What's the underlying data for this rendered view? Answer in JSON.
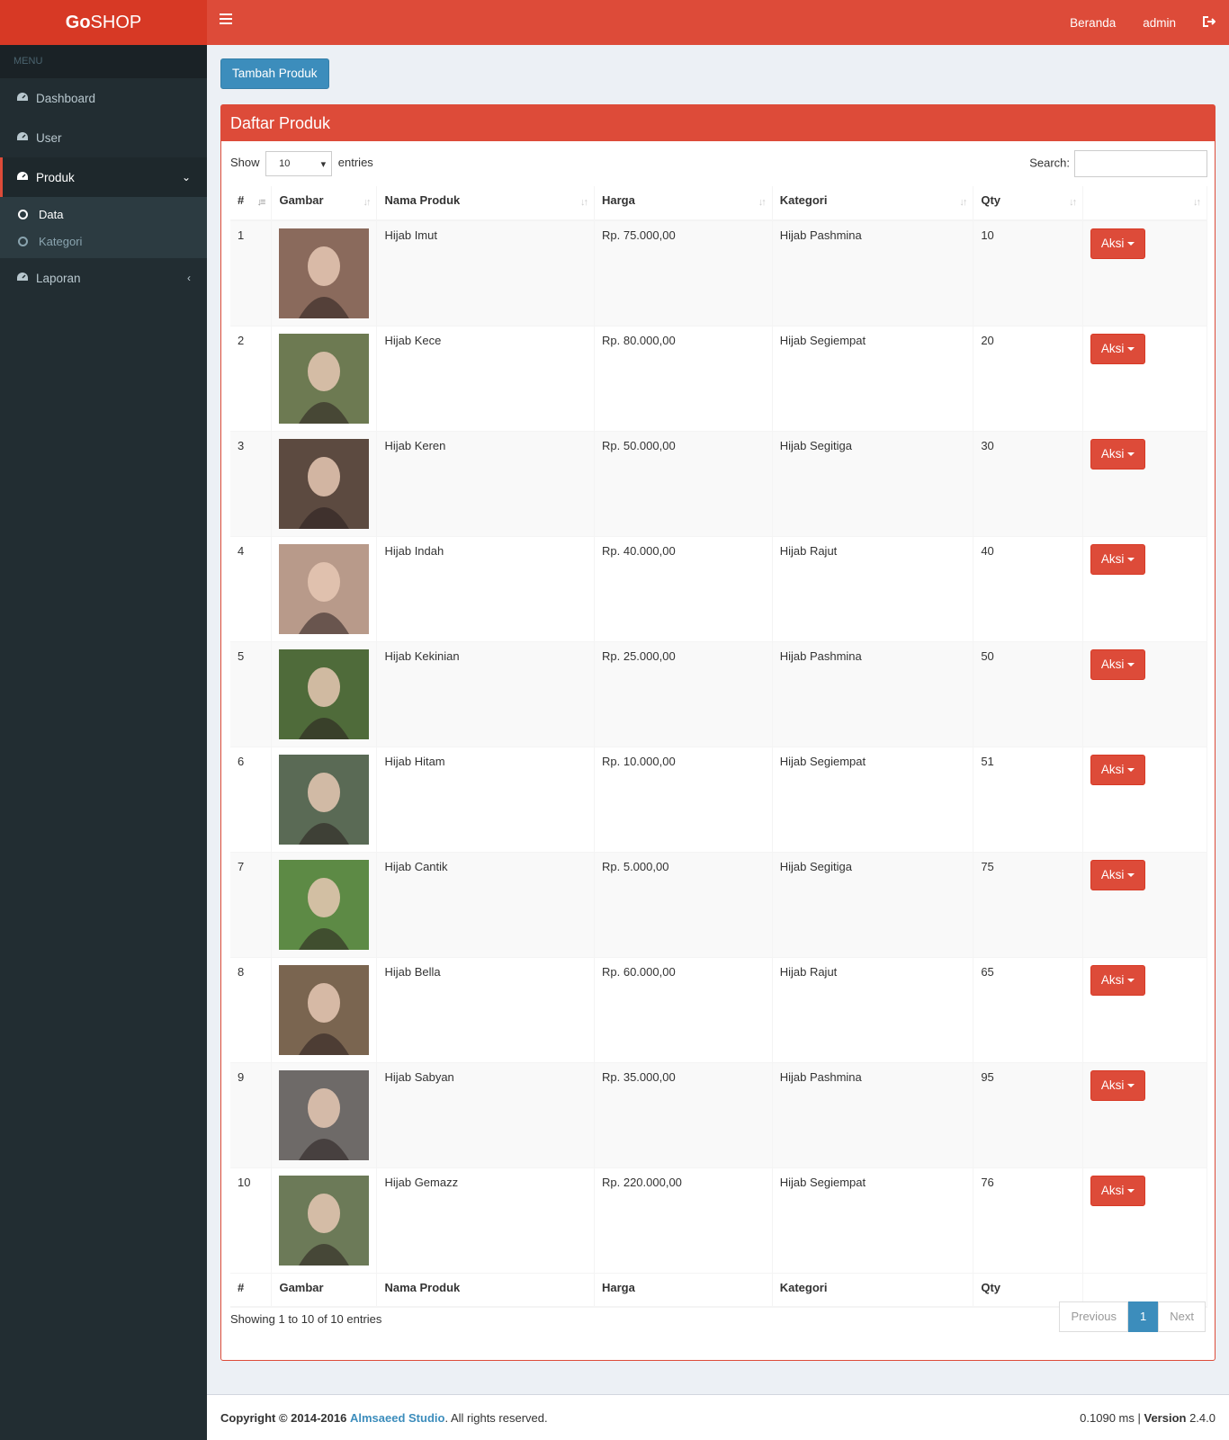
{
  "brand": {
    "bold": "Go",
    "rest": "SHOP"
  },
  "sidebar": {
    "header": "MENU",
    "items": [
      {
        "label": "Dashboard",
        "icon": "dashboard-icon"
      },
      {
        "label": "User",
        "icon": "dashboard-icon"
      },
      {
        "label": "Produk",
        "icon": "dashboard-icon"
      },
      {
        "label": "Laporan",
        "icon": "dashboard-icon"
      }
    ],
    "submenu": [
      {
        "label": "Data"
      },
      {
        "label": "Kategori"
      }
    ]
  },
  "topbar": {
    "home": "Beranda",
    "user": "admin"
  },
  "toolbar": {
    "add_label": "Tambah Produk"
  },
  "box": {
    "title": "Daftar Produk"
  },
  "datatable": {
    "show_label": "Show",
    "page_size": "10",
    "entries_label": "entries",
    "search_label": "Search:",
    "info": "Showing 1 to 10 of 10 entries",
    "prev": "Previous",
    "page": "1",
    "next": "Next"
  },
  "columns": [
    "#",
    "Gambar",
    "Nama Produk",
    "Harga",
    "Kategori",
    "Qty"
  ],
  "action_label": "Aksi",
  "rows": [
    {
      "no": "1",
      "nama": "Hijab Imut",
      "harga": "Rp. 75.000,00",
      "kategori": "Hijab Pashmina",
      "qty": "10",
      "color": "#8a6a5c"
    },
    {
      "no": "2",
      "nama": "Hijab Kece",
      "harga": "Rp. 80.000,00",
      "kategori": "Hijab Segiempat",
      "qty": "20",
      "color": "#6d7a52"
    },
    {
      "no": "3",
      "nama": "Hijab Keren",
      "harga": "Rp. 50.000,00",
      "kategori": "Hijab Segitiga",
      "qty": "30",
      "color": "#5c4a40"
    },
    {
      "no": "4",
      "nama": "Hijab Indah",
      "harga": "Rp. 40.000,00",
      "kategori": "Hijab Rajut",
      "qty": "40",
      "color": "#b89a8a"
    },
    {
      "no": "5",
      "nama": "Hijab Kekinian",
      "harga": "Rp. 25.000,00",
      "kategori": "Hijab Pashmina",
      "qty": "50",
      "color": "#4f6b3a"
    },
    {
      "no": "6",
      "nama": "Hijab Hitam",
      "harga": "Rp. 10.000,00",
      "kategori": "Hijab Segiempat",
      "qty": "51",
      "color": "#5a6a55"
    },
    {
      "no": "7",
      "nama": "Hijab Cantik",
      "harga": "Rp. 5.000,00",
      "kategori": "Hijab Segitiga",
      "qty": "75",
      "color": "#5d8a45"
    },
    {
      "no": "8",
      "nama": "Hijab Bella",
      "harga": "Rp. 60.000,00",
      "kategori": "Hijab Rajut",
      "qty": "65",
      "color": "#7a6550"
    },
    {
      "no": "9",
      "nama": "Hijab Sabyan",
      "harga": "Rp. 35.000,00",
      "kategori": "Hijab Pashmina",
      "qty": "95",
      "color": "#6e6a68"
    },
    {
      "no": "10",
      "nama": "Hijab Gemazz",
      "harga": "Rp. 220.000,00",
      "kategori": "Hijab Segiempat",
      "qty": "76",
      "color": "#6c7a58"
    }
  ],
  "footer": {
    "copyright": "Copyright © 2014-2016",
    "company": "Almsaeed Studio",
    "rights": ". All rights reserved.",
    "timing": "0.1090 ms |",
    "version_label": "Version",
    "version": "2.4.0"
  }
}
